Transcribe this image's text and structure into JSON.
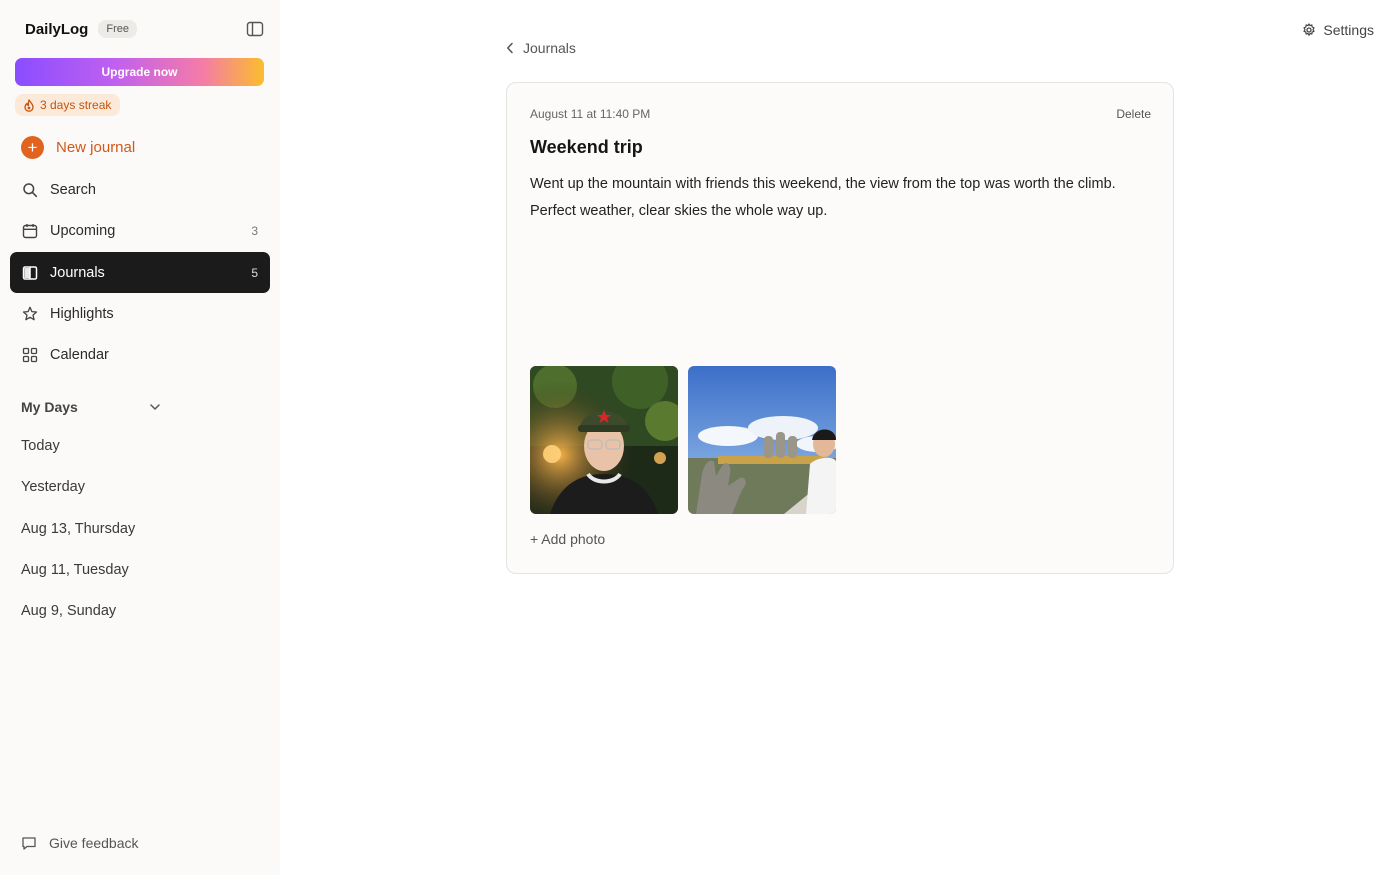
{
  "app": {
    "name": "DailyLog",
    "plan": "Free",
    "upgrade_label": "Upgrade now",
    "streak_label": "3 days streak"
  },
  "sidebar": {
    "new_journal_label": "New journal",
    "nav": [
      {
        "label": "Search",
        "count": "",
        "icon": "search-icon",
        "active": false
      },
      {
        "label": "Upcoming",
        "count": "3",
        "icon": "calendar-icon",
        "active": false
      },
      {
        "label": "Journals",
        "count": "5",
        "icon": "book-icon",
        "active": true
      },
      {
        "label": "Highlights",
        "count": "",
        "icon": "star-icon",
        "active": false
      },
      {
        "label": "Calendar",
        "count": "",
        "icon": "grid-icon",
        "active": false
      }
    ],
    "section_title": "My Days",
    "days": [
      "Today",
      "Yesterday",
      "Aug 13, Thursday",
      "Aug 11, Tuesday",
      "Aug 9, Sunday"
    ],
    "feedback_label": "Give feedback"
  },
  "header": {
    "settings_label": "Settings",
    "back_label": "Journals"
  },
  "entry": {
    "date": "August 11 at 11:40 PM",
    "delete_label": "Delete",
    "title": "Weekend trip",
    "body": "Went up the mountain with friends this weekend, the view from the top was worth the climb. Perfect weather, clear skies the whole way up.",
    "add_photo_label": "+ Add photo"
  },
  "colors": {
    "accent": "#e0641f",
    "active_nav_bg": "#1b1b1b",
    "sidebar_bg": "#fcfaf8"
  }
}
